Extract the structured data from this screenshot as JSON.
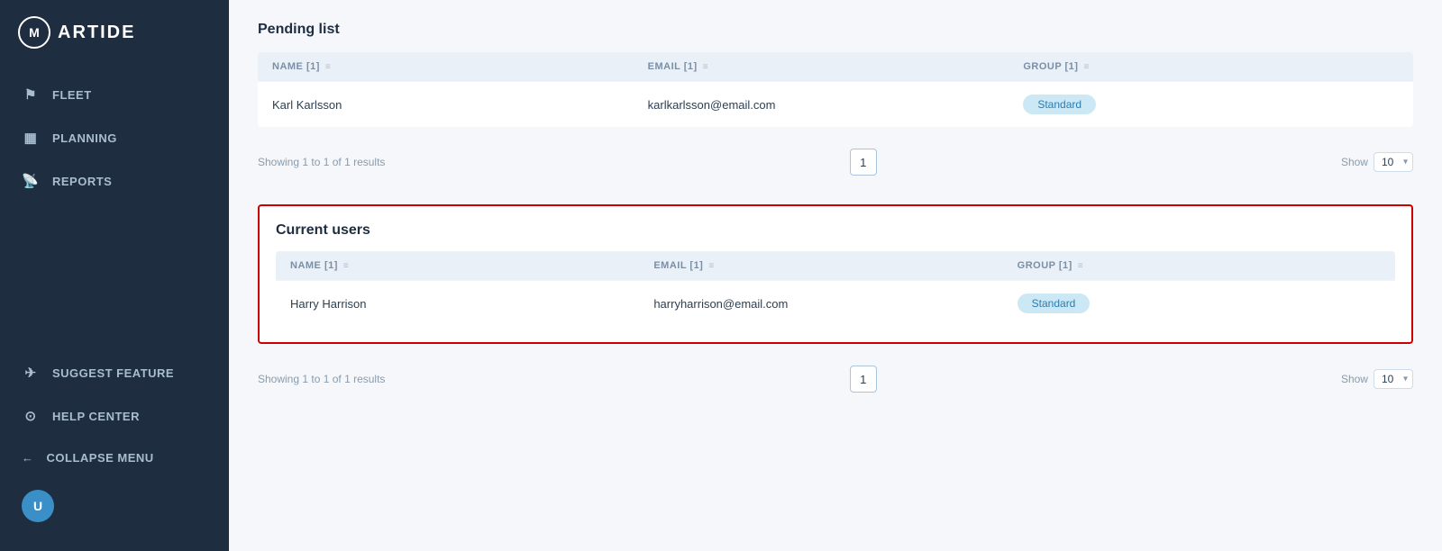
{
  "logo": {
    "symbol": "M",
    "brand": "ARTIDE"
  },
  "sidebar": {
    "items": [
      {
        "id": "fleet",
        "label": "FLEET",
        "icon": "⚑"
      },
      {
        "id": "planning",
        "label": "PLANNING",
        "icon": "▦"
      },
      {
        "id": "reports",
        "label": "REPORTS",
        "icon": "📡"
      },
      {
        "id": "suggest",
        "label": "SUGGEST FEATURE",
        "icon": "✈"
      },
      {
        "id": "help",
        "label": "HELP CENTER",
        "icon": "⊙"
      }
    ],
    "collapse_label": "COLLAPSE MENU",
    "collapse_icon": "←"
  },
  "pending": {
    "title": "Pending list",
    "columns": [
      {
        "label": "NAME [1]"
      },
      {
        "label": "EMAIL [1]"
      },
      {
        "label": "GROUP [1]"
      }
    ],
    "rows": [
      {
        "name": "Karl Karlsson",
        "email": "karlkarlsson@email.com",
        "group": "Standard"
      }
    ],
    "pagination": {
      "showing": "Showing 1 to 1 of 1 results",
      "page": "1",
      "show_label": "Show",
      "show_value": "10"
    }
  },
  "current": {
    "title": "Current users",
    "columns": [
      {
        "label": "NAME [1]"
      },
      {
        "label": "EMAIL [1]"
      },
      {
        "label": "GROUP [1]"
      }
    ],
    "rows": [
      {
        "name": "Harry Harrison",
        "email": "harryharrison@email.com",
        "group": "Standard"
      }
    ],
    "pagination": {
      "showing": "Showing 1 to 1 of 1 results",
      "page": "1",
      "show_label": "Show",
      "show_value": "10"
    }
  }
}
